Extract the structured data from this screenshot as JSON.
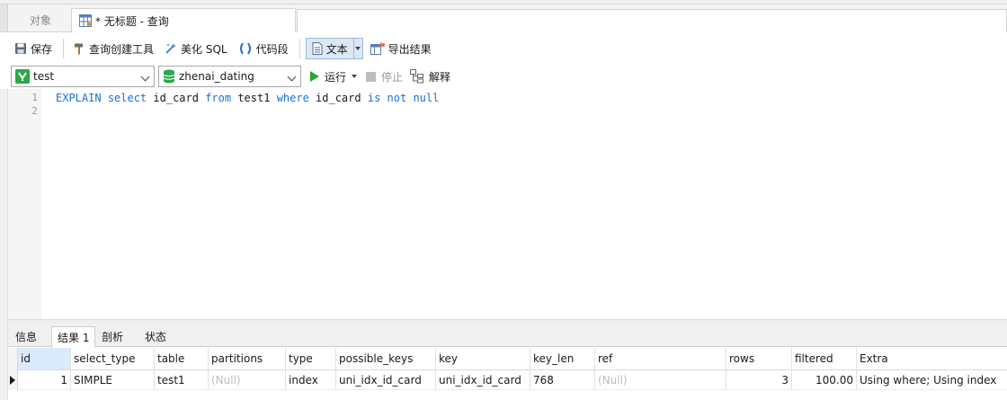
{
  "tabs": {
    "objects_label": "对象",
    "query_label": "* 无标题 - 查询"
  },
  "toolbar": {
    "save_label": "保存",
    "query_builder_label": "查询创建工具",
    "beautify_label": "美化 SQL",
    "snippet_label": "代码段",
    "text_label": "文本",
    "export_label": "导出结果"
  },
  "connection": {
    "connection_value": "test",
    "database_value": "zhenai_dating",
    "run_label": "运行",
    "stop_label": "停止",
    "explain_label": "解释"
  },
  "editor": {
    "line_numbers": [
      "1",
      "2"
    ],
    "tokens": {
      "t1": "EXPLAIN",
      "t2": " ",
      "t3": "select",
      "t4": " id_card ",
      "t5": "from",
      "t6": " test1 ",
      "t7": "where",
      "t8": " id_card ",
      "t9": "is",
      "t10": " ",
      "t11": "not",
      "t12": " ",
      "t13": "null"
    }
  },
  "result_tabs": {
    "info": "信息",
    "result1": "结果 1",
    "profile": "剖析",
    "status": "状态"
  },
  "grid": {
    "columns": [
      "id",
      "select_type",
      "table",
      "partitions",
      "type",
      "possible_keys",
      "key",
      "key_len",
      "ref",
      "rows",
      "filtered",
      "Extra"
    ],
    "row": [
      "1",
      "SIMPLE",
      "test1",
      "(Null)",
      "index",
      "uni_idx_id_card",
      "uni_idx_id_card",
      "768",
      "(Null)",
      "3",
      "100.00",
      "Using where; Using index"
    ]
  },
  "colors": {
    "keyword": "#1a6fd6",
    "run_green": "#2ba52e",
    "null_gray": "#bcbcbc",
    "selected_header": "#dcebfb"
  }
}
